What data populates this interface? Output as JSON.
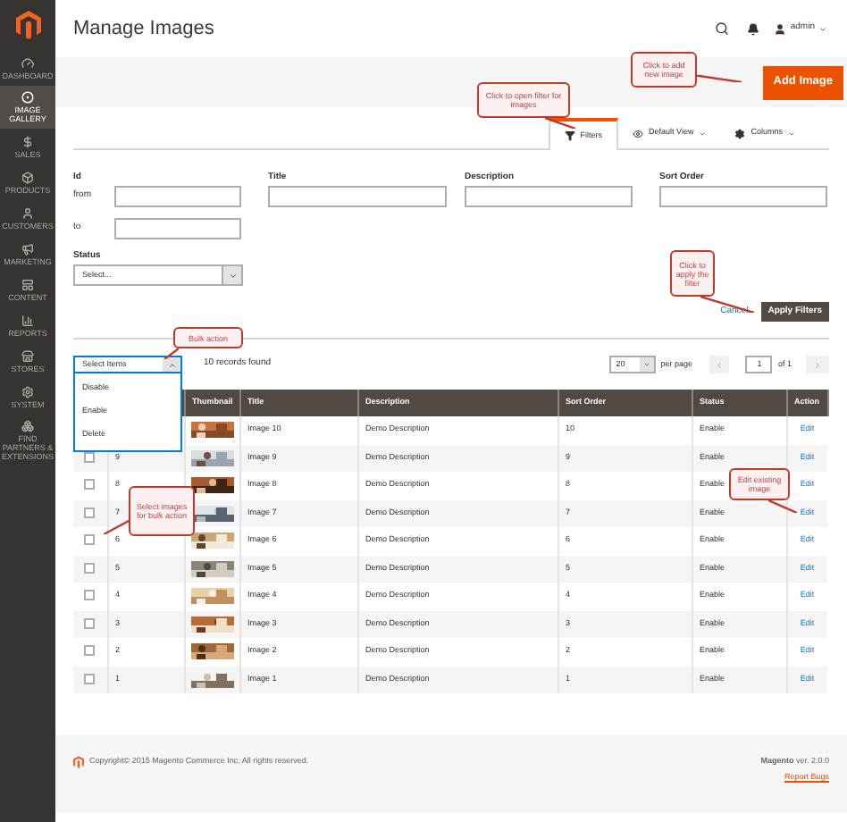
{
  "sidebar": {
    "items": [
      {
        "label": "DASHBOARD",
        "selected": false
      },
      {
        "label": "IMAGE GALLERY",
        "selected": true
      },
      {
        "label": "SALES",
        "selected": false
      },
      {
        "label": "PRODUCTS",
        "selected": false
      },
      {
        "label": "CUSTOMERS",
        "selected": false
      },
      {
        "label": "MARKETING",
        "selected": false
      },
      {
        "label": "CONTENT",
        "selected": false
      },
      {
        "label": "REPORTS",
        "selected": false
      },
      {
        "label": "STORES",
        "selected": false
      },
      {
        "label": "SYSTEM",
        "selected": false
      },
      {
        "label": "FIND PARTNERS & EXTENSIONS",
        "selected": false
      }
    ]
  },
  "header": {
    "title": "Manage Images",
    "user": "admin"
  },
  "add_button": "Add Image",
  "toolbar": {
    "tabs": [
      {
        "label": "Filters",
        "selected": true
      },
      {
        "label": "Default View",
        "selected": false
      },
      {
        "label": "Columns",
        "selected": false
      }
    ]
  },
  "filters": {
    "id_label": "Id",
    "from_label": "from",
    "to_label": "to",
    "title_label": "Title",
    "description_label": "Description",
    "sort_order_label": "Sort Order",
    "status_label": "Status",
    "status_select": "Select...",
    "cancel": "Cancel",
    "apply": "Apply Filters"
  },
  "bulk": {
    "value": "Select Items",
    "expanded": true,
    "menu": [
      "Disable",
      "Enable",
      "Delete"
    ],
    "records": "10 records found"
  },
  "pager": {
    "per_page_value": "20",
    "per_page_label": "per page",
    "page": "1",
    "of": "of 1"
  },
  "table": {
    "columns": [
      "Thumbnail",
      "Title",
      "Description",
      "Sort Order",
      "Status",
      "Action"
    ],
    "rows": [
      {
        "title": "Image 10",
        "description": "Demo Description",
        "sort_order": "10",
        "status": "Enable",
        "action": "Edit"
      },
      {
        "checked": false,
        "id": "9",
        "title": "Image 9",
        "description": "Demo Description",
        "sort_order": "9",
        "status": "Enable",
        "action": "Edit"
      },
      {
        "checked": false,
        "id": "8",
        "title": "Image 8",
        "description": "Demo Description",
        "sort_order": "8",
        "status": "Enable",
        "action": "Edit"
      },
      {
        "checked": false,
        "id": "7",
        "title": "Image 7",
        "description": "Demo Description",
        "sort_order": "7",
        "status": "Enable",
        "action": "Edit"
      },
      {
        "checked": false,
        "id": "6",
        "title": "Image 6",
        "description": "Demo Description",
        "sort_order": "6",
        "status": "Enable",
        "action": "Edit"
      },
      {
        "checked": false,
        "id": "5",
        "title": "Image 5",
        "description": "Demo Description",
        "sort_order": "5",
        "status": "Enable",
        "action": "Edit"
      },
      {
        "checked": false,
        "id": "4",
        "title": "Image 4",
        "description": "Demo Description",
        "sort_order": "4",
        "status": "Enable",
        "action": "Edit"
      },
      {
        "checked": false,
        "id": "3",
        "title": "Image 3",
        "description": "Demo Description",
        "sort_order": "3",
        "status": "Enable",
        "action": "Edit"
      },
      {
        "checked": false,
        "id": "2",
        "title": "Image 2",
        "description": "Demo Description",
        "sort_order": "2",
        "status": "Enable",
        "action": "Edit"
      },
      {
        "checked": false,
        "id": "1",
        "title": "Image 1",
        "description": "Demo Description",
        "sort_order": "1",
        "status": "Enable",
        "action": "Edit"
      }
    ]
  },
  "footer": {
    "copyright": "Copyright© 2015 Magento Commerce Inc. All rights reserved.",
    "version": "**Magento** ver. 2.0.0",
    "report": "Report Bugs"
  },
  "callouts": [
    "Click to add new image",
    "Click to open filter for images",
    "Click to apply the filter",
    "Bulk action",
    "Select images for bulk action",
    "Edit existing image"
  ]
}
